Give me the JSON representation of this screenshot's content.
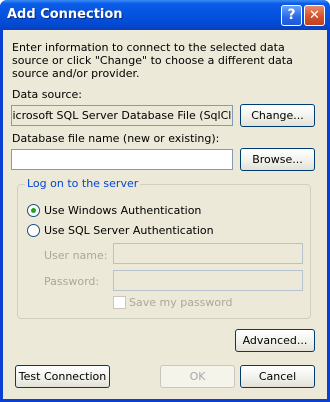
{
  "window": {
    "title": "Add Connection",
    "help_glyph": "?",
    "close_glyph": "✕"
  },
  "intro_text": "Enter information to connect to the selected data source or click \"Change\" to choose a different data source and/or provider.",
  "data_source": {
    "label": "Data source:",
    "value": "Microsoft SQL Server Database File (SqlClient)",
    "change_label": "Change..."
  },
  "database_file": {
    "label": "Database file name (new or existing):",
    "value": "",
    "browse_label": "Browse..."
  },
  "logon": {
    "legend": "Log on to the server",
    "windows_auth_label": "Use Windows Authentication",
    "sql_auth_label": "Use SQL Server Authentication",
    "selected": "windows",
    "username_label": "User name:",
    "username_value": "",
    "password_label": "Password:",
    "password_value": "",
    "save_password_label": "Save my password",
    "save_password_checked": false
  },
  "buttons": {
    "advanced": "Advanced...",
    "test_connection": "Test Connection",
    "ok": "OK",
    "cancel": "Cancel"
  },
  "colors": {
    "title_blue": "#0553e0",
    "dialog_bg": "#ece9d8",
    "group_legend": "#0046d5",
    "radio_dot": "#21a121"
  }
}
